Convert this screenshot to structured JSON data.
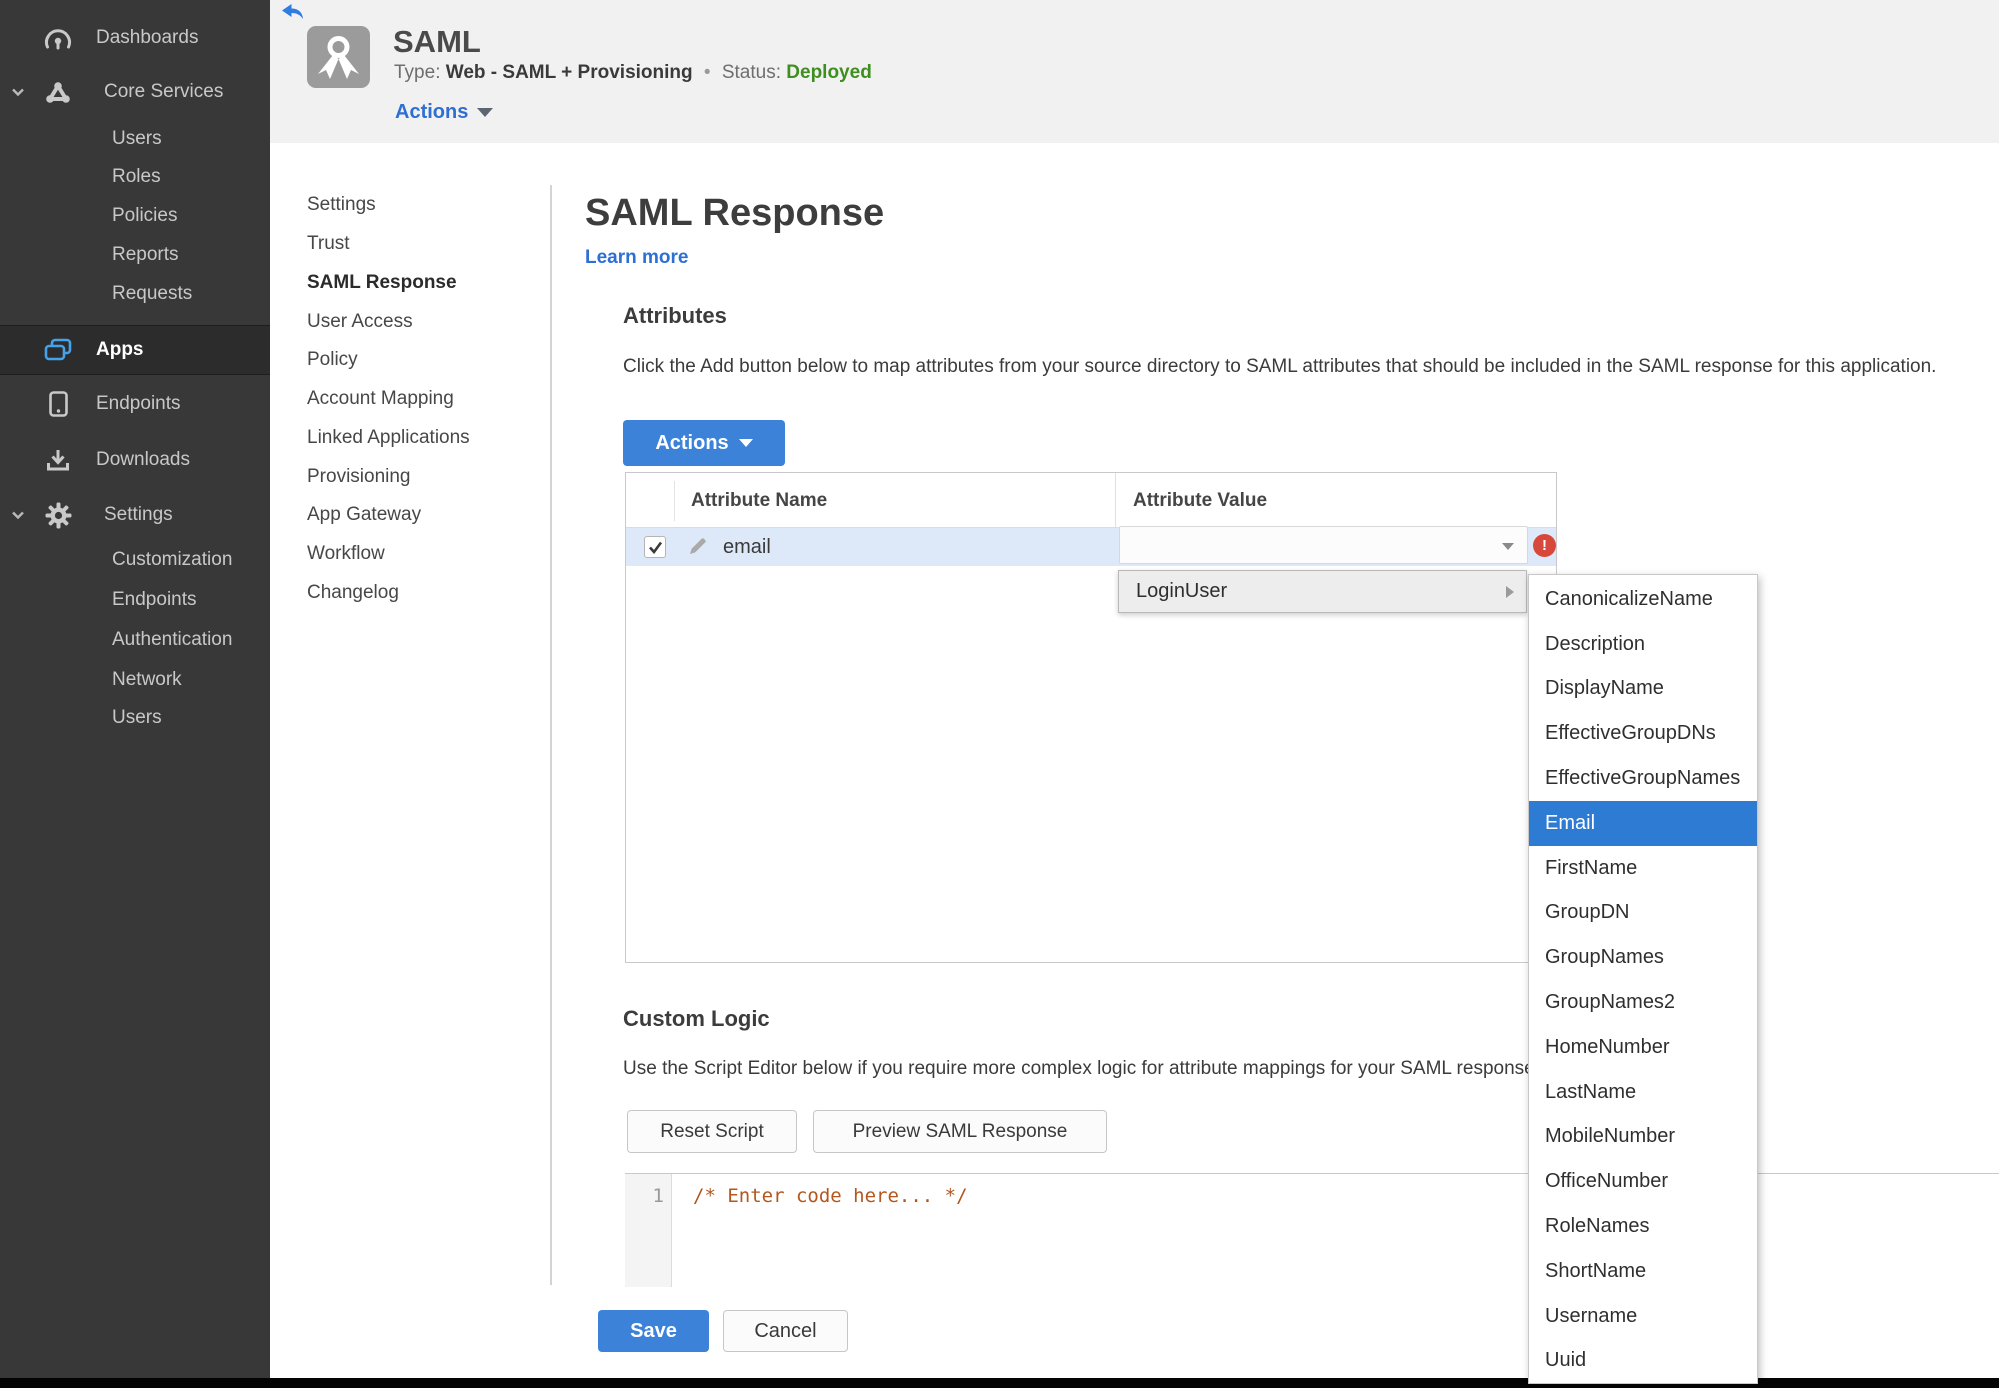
{
  "colors": {
    "accent": "#3b82d8",
    "link": "#2d6fd2",
    "status_green": "#3e8e20",
    "error_red": "#d7473b",
    "row_highlight": "#dde9f8",
    "menu_highlight": "#2e7bd4",
    "code_orange": "#b4571e",
    "sidebar_bg": "#383838",
    "sidebar_active_bg": "#2c2c2c",
    "header_bg": "#f1f1f1"
  },
  "sidebar": {
    "items": [
      {
        "label": "Dashboards",
        "icon": "gauge-icon",
        "level": "top"
      },
      {
        "label": "Core Services",
        "icon": "core-services-icon",
        "level": "group",
        "chevron": true
      },
      {
        "label": "Users",
        "level": "sub"
      },
      {
        "label": "Roles",
        "level": "sub"
      },
      {
        "label": "Policies",
        "level": "sub"
      },
      {
        "label": "Reports",
        "level": "sub"
      },
      {
        "label": "Requests",
        "level": "sub"
      },
      {
        "label": "Apps",
        "icon": "apps-icon",
        "level": "top",
        "active": true
      },
      {
        "label": "Endpoints",
        "icon": "device-icon",
        "level": "top"
      },
      {
        "label": "Downloads",
        "icon": "download-icon",
        "level": "top"
      },
      {
        "label": "Settings",
        "icon": "gear-icon",
        "level": "group",
        "chevron": true
      },
      {
        "label": "Customization",
        "level": "sub"
      },
      {
        "label": "Endpoints",
        "level": "sub"
      },
      {
        "label": "Authentication",
        "level": "sub"
      },
      {
        "label": "Network",
        "level": "sub"
      },
      {
        "label": "Users",
        "level": "sub"
      }
    ]
  },
  "header": {
    "title": "SAML",
    "type_label": "Type:",
    "type_value": "Web - SAML + Provisioning",
    "separator": "•",
    "status_label": "Status:",
    "status_value": "Deployed",
    "actions_label": "Actions"
  },
  "subnav": {
    "active_index": 2,
    "items": [
      "Settings",
      "Trust",
      "SAML Response",
      "User Access",
      "Policy",
      "Account Mapping",
      "Linked Applications",
      "Provisioning",
      "App Gateway",
      "Workflow",
      "Changelog"
    ]
  },
  "main": {
    "title": "SAML Response",
    "learn_more": "Learn more",
    "attributes": {
      "heading": "Attributes",
      "description": "Click the Add button below to map attributes from your source directory to SAML attributes that should be included in the SAML response for this application.",
      "actions_button": "Actions",
      "table": {
        "col_name": "Attribute Name",
        "col_value": "Attribute Value",
        "row": {
          "name": "email",
          "value": "",
          "checked": true,
          "error": "!"
        }
      }
    },
    "custom_logic": {
      "heading": "Custom Logic",
      "description": "Use the Script Editor below if you require more complex logic for attribute mappings for your SAML response.",
      "reset_button": "Reset Script",
      "preview_button": "Preview SAML Response",
      "editor": {
        "line_number": "1",
        "code": "/* Enter code here... */"
      }
    },
    "save_button": "Save",
    "cancel_button": "Cancel"
  },
  "value_menu": {
    "item": "LoginUser",
    "selected": "Email",
    "submenu": [
      "CanonicalizeName",
      "Description",
      "DisplayName",
      "EffectiveGroupDNs",
      "EffectiveGroupNames",
      "Email",
      "FirstName",
      "GroupDN",
      "GroupNames",
      "GroupNames2",
      "HomeNumber",
      "LastName",
      "MobileNumber",
      "OfficeNumber",
      "RoleNames",
      "ShortName",
      "Username",
      "Uuid"
    ]
  }
}
